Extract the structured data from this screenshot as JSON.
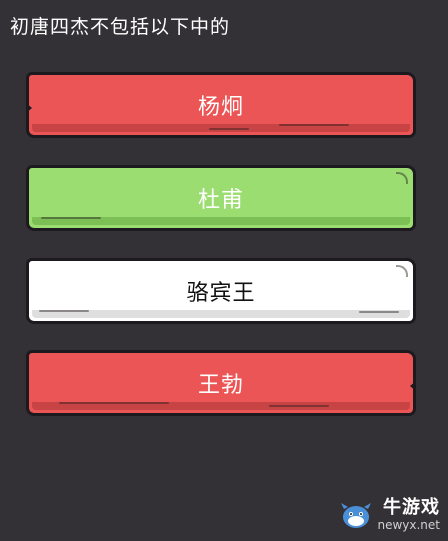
{
  "question": "初唐四杰不包括以下中的",
  "options": [
    {
      "label": "杨炯",
      "color": "red"
    },
    {
      "label": "杜甫",
      "color": "green"
    },
    {
      "label": "骆宾王",
      "color": "white"
    },
    {
      "label": "王勃",
      "color": "red"
    }
  ],
  "colors": {
    "background": "#333135",
    "red": "#eb5555",
    "green": "#9bdd71",
    "white": "#ffffff"
  },
  "watermark": {
    "brand_cn": "牛游戏",
    "brand_en": "newyx.net",
    "icon": "cow-mascot-icon"
  }
}
